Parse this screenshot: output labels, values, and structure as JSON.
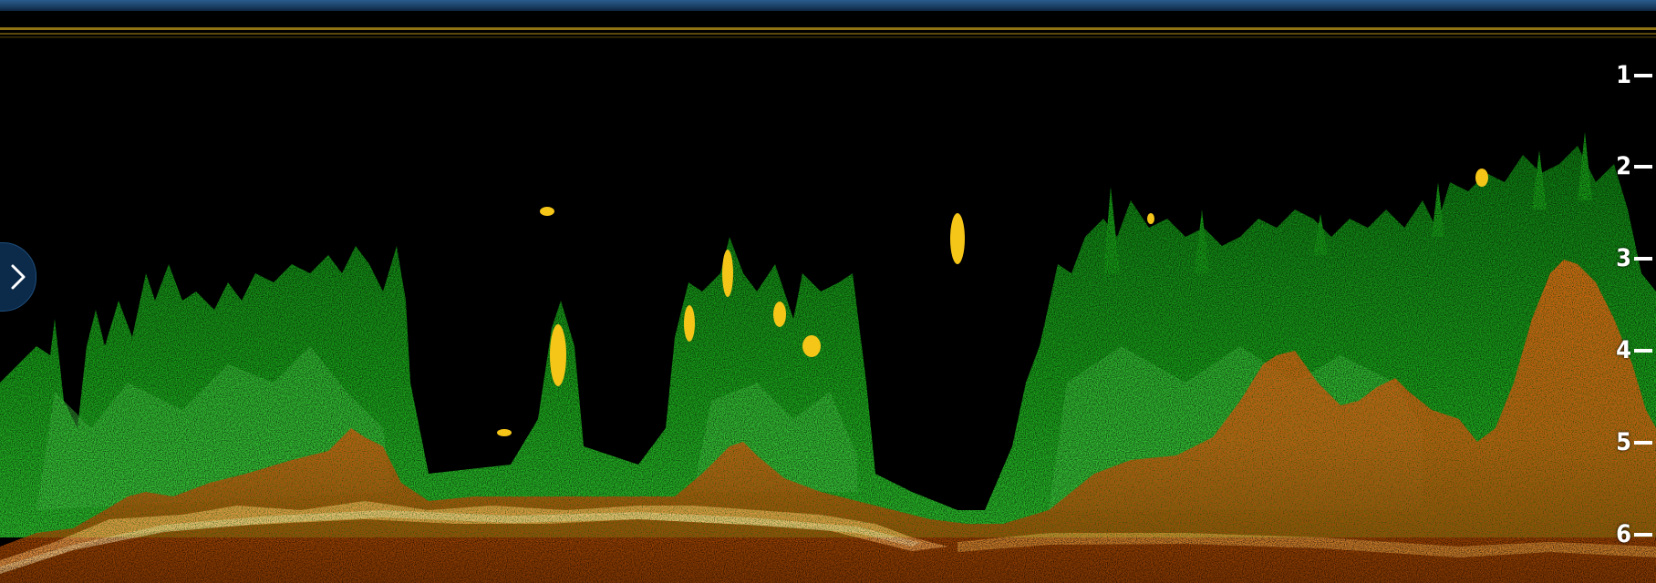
{
  "screen": {
    "type": "sonar-echogram",
    "colors": {
      "background": "#000000",
      "top_bar": "#1f4a75",
      "surface_noise": "#c9a21a",
      "weak_return": "#1faa1f",
      "medium_return": "#39d339",
      "strong_return": "#ffe14a",
      "bottom_dark": "#b84d00",
      "bottom_mid": "#e06a0c",
      "bottom_bright": "#ffb347",
      "scale_text": "#ffffff",
      "toggle_bg": "#0c2a4a"
    }
  },
  "depth_scale": {
    "labels": [
      "1",
      "2",
      "3",
      "4",
      "5",
      "6"
    ]
  },
  "side_panel_toggle": {
    "icon": "chevron-right-icon"
  }
}
